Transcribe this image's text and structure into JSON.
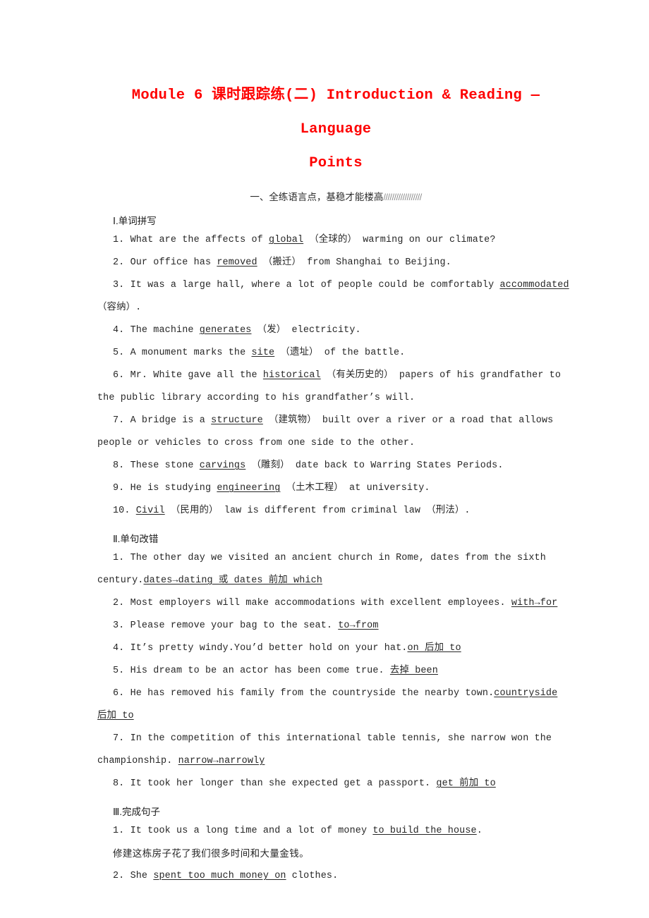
{
  "title": {
    "line1": "Module 6 课时跟踪练(二) Introduction & Reading — Language",
    "line2": "Points"
  },
  "banner": {
    "text": "一、全练语言点，基稳才能楼高",
    "slashes": "//////////////////",
    "color": "#8d8d8d"
  },
  "title_color": "#fe0000",
  "parts": [
    {
      "heading": "Ⅰ.单词拼写"
    },
    {
      "heading": "Ⅱ.单句改错"
    },
    {
      "heading": "Ⅲ.完成句子"
    }
  ],
  "part1": {
    "heading": "Ⅰ.单词拼写",
    "items": [
      {
        "num": "1.",
        "pre": "What are the affects of ",
        "ans": "global",
        "post": " （全球的） warming on our climate?"
      },
      {
        "num": "2.",
        "pre": "Our office has ",
        "ans": "removed",
        "post": " （搬迁） from Shanghai to Beijing."
      },
      {
        "num": "3.",
        "pre": "It was a large hall, where a lot of people could be comfortably ",
        "ans": "accommodated",
        "post": ""
      },
      {
        "num": "",
        "pre": "（容纳）.",
        "ans": "",
        "post": ""
      },
      {
        "num": "4.",
        "pre": "The machine ",
        "ans": "generates",
        "post": " （发） electricity."
      },
      {
        "num": "5.",
        "pre": "A monument marks the ",
        "ans": "site",
        "post": " （遗址） of the battle."
      },
      {
        "num": "6.",
        "pre": "Mr. White gave all the ",
        "ans": "historical",
        "post": " （有关历史的） papers of his grandfather to"
      },
      {
        "num": "",
        "pre": "the public library according to his grandfather’s will.",
        "ans": "",
        "post": ""
      },
      {
        "num": "7.",
        "pre": "A bridge is a ",
        "ans": "structure",
        "post": " （建筑物） built over a river or a road that allows"
      },
      {
        "num": "",
        "pre": "people or vehicles to cross from one side to the other.",
        "ans": "",
        "post": ""
      },
      {
        "num": "8.",
        "pre": "These stone ",
        "ans": "carvings",
        "post": " （雕刻） date back to Warring States Periods."
      },
      {
        "num": "9.",
        "pre": "He is studying ",
        "ans": "engineering",
        "post": " （土木工程） at university."
      },
      {
        "num": "10.",
        "pre": " ",
        "ans": "Civil",
        "post": " （民用的） law is different from criminal law （刑法）."
      }
    ]
  },
  "part2": {
    "heading": "Ⅱ.单句改错",
    "items": [
      {
        "num": "1.",
        "pre": "The other day we visited an ancient church in Rome, dates from the sixth",
        "ans": "",
        "post": ""
      },
      {
        "num": "",
        "pre": "century.",
        "ans": "dates→dating 或 dates 前加 which",
        "post": ""
      },
      {
        "num": "2.",
        "pre": "Most employers will make accommodations with excellent employees. ",
        "ans": "with→for",
        "post": ""
      },
      {
        "num": "3.",
        "pre": "Please remove your bag to the seat. ",
        "ans": "to→from",
        "post": ""
      },
      {
        "num": "4.",
        "pre": "It’s pretty windy.You’d better hold on your hat.",
        "ans": "on 后加 to",
        "post": ""
      },
      {
        "num": "5.",
        "pre": "His dream to be an actor has been come true. ",
        "ans": "去掉 been",
        "post": ""
      },
      {
        "num": "6.",
        "pre": "He has removed his family from the countryside the nearby town.",
        "ans": "countryside",
        "post": ""
      },
      {
        "num": "",
        "pre": "",
        "ans": "后加 to",
        "post": ""
      },
      {
        "num": "7.",
        "pre": "In the competition of this international table tennis, she narrow won the",
        "ans": "",
        "post": ""
      },
      {
        "num": "",
        "pre": "championship. ",
        "ans": "narrow→narrowly",
        "post": ""
      },
      {
        "num": "8.",
        "pre": "It took her longer than she expected get a passport. ",
        "ans": "get 前加 to",
        "post": ""
      }
    ]
  },
  "part3": {
    "heading": "Ⅲ.完成句子",
    "items": [
      {
        "num": "1.",
        "pre": "It took us a long time and a lot of money ",
        "ans": "to build the house",
        "post": "."
      },
      {
        "num": "",
        "pre": "修建这栋房子花了我们很多时间和大量金钱。",
        "ans": "",
        "post": "",
        "chinese": true
      },
      {
        "num": "2.",
        "pre": "She ",
        "ans": "spent too much money on",
        "post": " clothes."
      }
    ]
  }
}
